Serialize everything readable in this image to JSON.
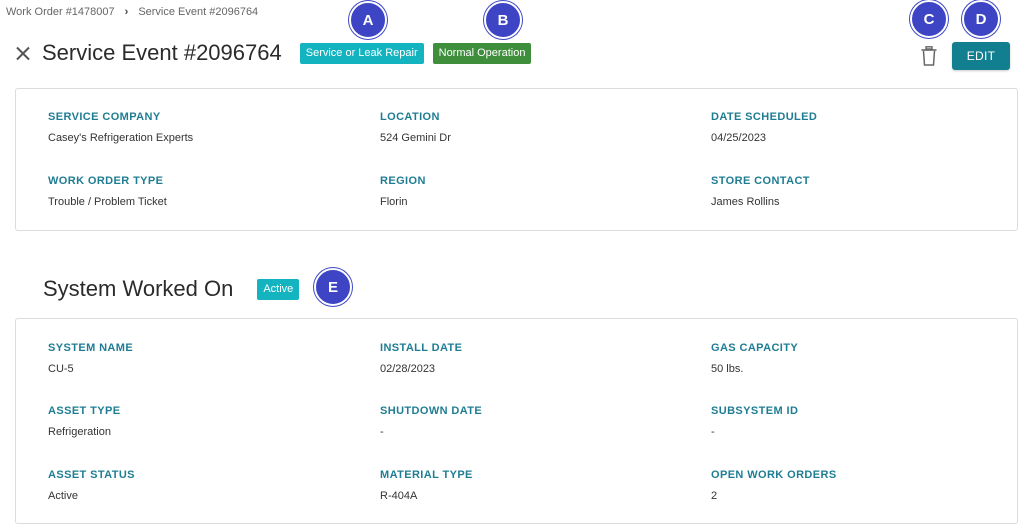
{
  "breadcrumb": {
    "work_order": "Work Order #1478007",
    "separator": "›",
    "service_event": "Service Event #2096764"
  },
  "header": {
    "title": "Service Event #2096764",
    "badge_type": "Service or Leak Repair",
    "badge_status": "Normal Operation",
    "edit_label": "EDIT"
  },
  "details": {
    "service_company": {
      "label": "SERVICE COMPANY",
      "value": "Casey's Refrigeration Experts"
    },
    "location": {
      "label": "LOCATION",
      "value": "524 Gemini Dr"
    },
    "date_scheduled": {
      "label": "DATE SCHEDULED",
      "value": "04/25/2023"
    },
    "work_order_type": {
      "label": "WORK ORDER TYPE",
      "value": "Trouble / Problem Ticket"
    },
    "region": {
      "label": "REGION",
      "value": "Florin"
    },
    "store_contact": {
      "label": "STORE CONTACT",
      "value": "James Rollins"
    }
  },
  "system": {
    "title": "System Worked On",
    "badge": "Active",
    "system_name": {
      "label": "SYSTEM NAME",
      "value": "CU-5"
    },
    "install_date": {
      "label": "INSTALL DATE",
      "value": "02/28/2023"
    },
    "gas_capacity": {
      "label": "GAS CAPACITY",
      "value": "50 lbs."
    },
    "asset_type": {
      "label": "ASSET TYPE",
      "value": "Refrigeration"
    },
    "shutdown_date": {
      "label": "SHUTDOWN DATE",
      "value": "-"
    },
    "subsystem_id": {
      "label": "SUBSYSTEM ID",
      "value": "-"
    },
    "asset_status": {
      "label": "ASSET STATUS",
      "value": "Active"
    },
    "material_type": {
      "label": "MATERIAL TYPE",
      "value": "R-404A"
    },
    "open_work_orders": {
      "label": "OPEN WORK ORDERS",
      "value": "2"
    }
  },
  "markers": {
    "a": "A",
    "b": "B",
    "c": "C",
    "d": "D",
    "e": "E"
  },
  "icons": {
    "close": "close-icon",
    "trash": "trash-icon",
    "chevron": "chevron-right-icon"
  },
  "colors": {
    "teal_badge": "#14b3c0",
    "green_badge": "#3e8e3c",
    "edit_button": "#127f91",
    "label": "#1f7d93",
    "marker": "#3d45c5"
  }
}
